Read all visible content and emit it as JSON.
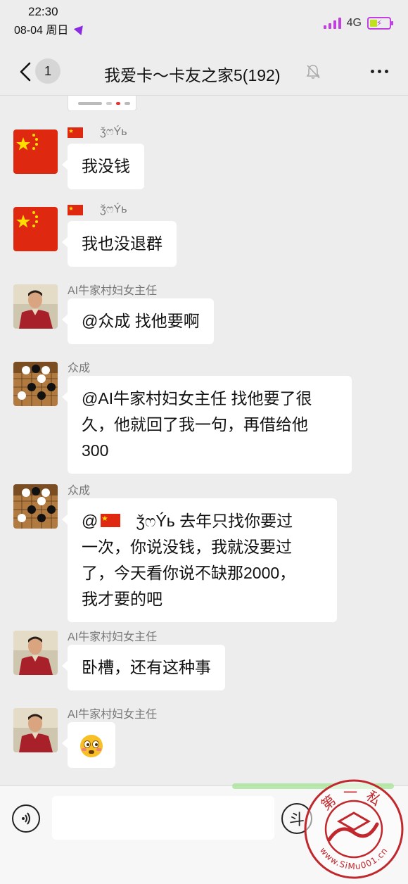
{
  "status_bar": {
    "time": "22:30",
    "date": "08-04 周日",
    "network": "4G"
  },
  "header": {
    "unread_count": "1",
    "title": "我爱卡～卡友之家5(192)"
  },
  "messages": [
    {
      "sender": "ǯෆÝь",
      "avatar": "china-flag",
      "text": "我没钱"
    },
    {
      "sender": "ǯෆÝь",
      "avatar": "china-flag",
      "text": "我也没退群"
    },
    {
      "sender": "AI牛家村妇女主任",
      "avatar": "man-photo",
      "text": "@众成 找他要啊"
    },
    {
      "sender": "众成",
      "avatar": "go-board-photo",
      "lines": [
        "@AI牛家村妇女主任 找他要了很",
        "久，他就回了我一句，再借给他",
        "300"
      ]
    },
    {
      "sender": "众成",
      "avatar": "go-board-photo",
      "mention_prefix": "@",
      "mention_name": "ǯෆÝь",
      "first_line_rest": " 去年只找你要过",
      "lines": [
        "一次，你说没钱，我就没要过",
        "了，今天看你说不缺那2000，",
        "我才要的吧"
      ]
    },
    {
      "sender": "AI牛家村妇女主任",
      "avatar": "man-photo",
      "text": "卧槽，还有这种事"
    },
    {
      "sender": "AI牛家村妇女主任",
      "avatar": "man-photo",
      "emoji": "flushed-face-emoji"
    }
  ],
  "input_bar": {
    "placeholder": "",
    "emoji_button_label": "斗"
  },
  "watermark": {
    "top_text": "第一私",
    "bottom_text": "www.SiMu001.cn"
  },
  "colors": {
    "background": "#ededed",
    "bubble": "#ffffff",
    "flag_red": "#de2910",
    "flag_yellow": "#ffde00",
    "accent_purple": "#c040e0",
    "watermark_red": "#c0282d"
  }
}
